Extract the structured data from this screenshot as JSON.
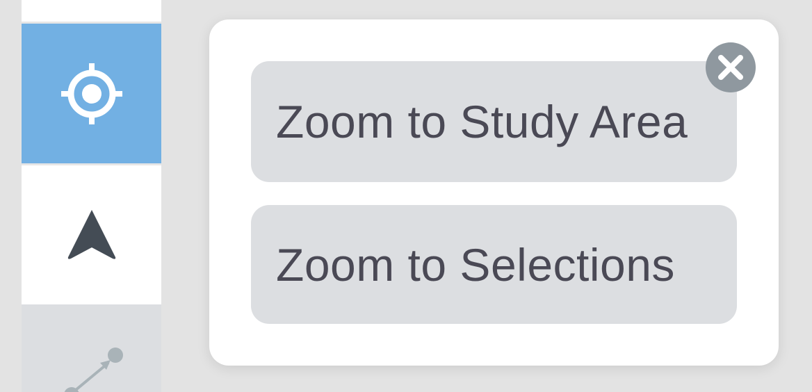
{
  "toolbar": {
    "tools": [
      {
        "name": "locate",
        "icon": "crosshair-icon",
        "active": true
      },
      {
        "name": "north-arrow",
        "icon": "navigation-arrow-icon",
        "active": false
      },
      {
        "name": "measure",
        "icon": "measure-line-icon",
        "active": false
      }
    ]
  },
  "popup": {
    "buttons": [
      {
        "label": "Zoom to Study Area"
      },
      {
        "label": "Zoom to Selections"
      }
    ],
    "close_icon": "close-icon"
  },
  "colors": {
    "active_tool": "#72b0e3",
    "button_bg": "#dcdee1",
    "button_text": "#4a4955",
    "close_bg": "#8f989f",
    "page_bg": "#e3e3e3"
  }
}
